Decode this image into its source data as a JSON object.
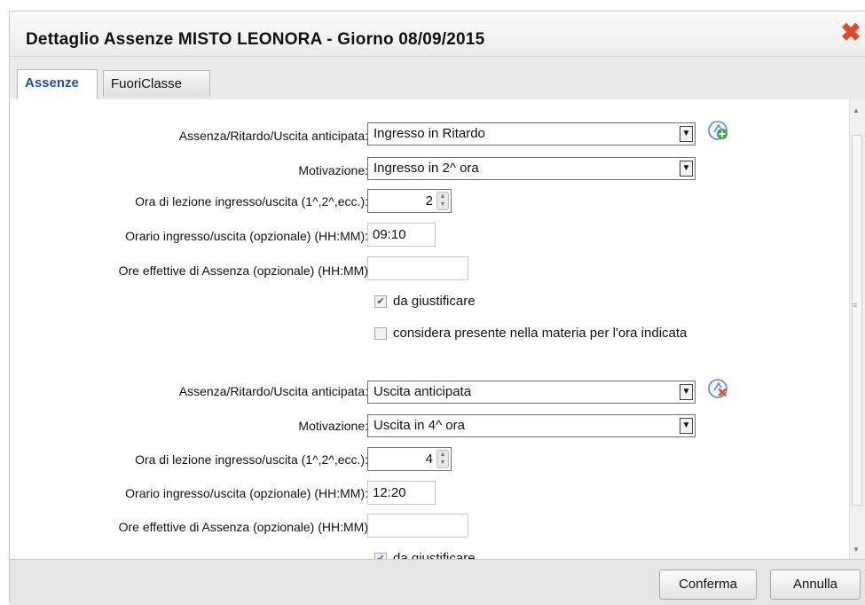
{
  "dialog": {
    "title": "Dettaglio Assenze MISTO LEONORA - Giorno 08/09/2015",
    "close_icon": "close-x-icon"
  },
  "tabs": [
    {
      "label": "Assenze",
      "active": true
    },
    {
      "label": "FuoriClasse",
      "active": false
    }
  ],
  "entries": [
    {
      "type_label": "Assenza/Ritardo/Uscita anticipata:",
      "type_value": "Ingresso in Ritardo",
      "action_icon": "add-green-plus-icon",
      "reason_label": "Motivazione:",
      "reason_value": "Ingresso in 2^ ora",
      "hour_label": "Ora di lezione ingresso/uscita (1^,2^,ecc.):",
      "hour_value": "2",
      "time_label": "Orario ingresso/uscita (opzionale) (HH:MM):",
      "time_value": "09:10",
      "effective_label": "Ore effettive di Assenza (opzionale) (HH:MM)",
      "effective_value": "",
      "justify_label": "da giustificare",
      "justify_checked": true,
      "present_label": "considera presente nella materia per l'ora indicata",
      "present_checked": false
    },
    {
      "type_label": "Assenza/Ritardo/Uscita anticipata:",
      "type_value": "Uscita anticipata",
      "action_icon": "remove-red-x-icon",
      "reason_label": "Motivazione:",
      "reason_value": "Uscita in 4^ ora",
      "hour_label": "Ora di lezione ingresso/uscita (1^,2^,ecc.):",
      "hour_value": "4",
      "time_label": "Orario ingresso/uscita (opzionale) (HH:MM):",
      "time_value": "12:20",
      "effective_label": "Ore effettive di Assenza (opzionale) (HH:MM)",
      "effective_value": "",
      "justify_label": "da giustificare",
      "justify_checked": true
    }
  ],
  "footer": {
    "confirm_label": "Conferma",
    "cancel_label": "Annulla"
  },
  "colors": {
    "active_tab": "#1f4fb8",
    "close_icon": "#e04b27",
    "add_icon": "#3aa84a",
    "remove_icon": "#e04b27"
  }
}
